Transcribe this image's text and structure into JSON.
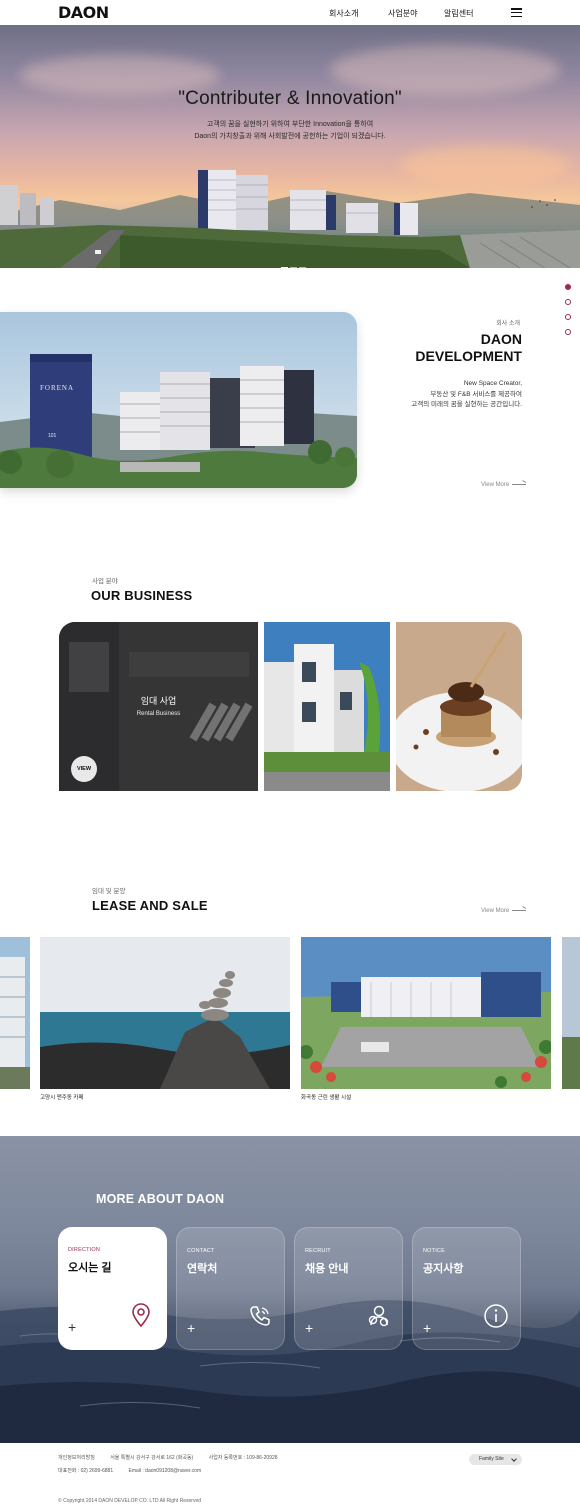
{
  "header": {
    "logo": "DAON",
    "nav": [
      "회사소개",
      "사업분야",
      "알림센터"
    ]
  },
  "hero": {
    "title": "\"Contributer & Innovation\"",
    "subtitle_line1": "고객의 꿈을 실현하기 위하여 부단한 Innovation을 통하여",
    "subtitle_line2": "Daon의 가치창출과 위해 사회발전에 공헌하는 기업이 되겠습니다."
  },
  "about": {
    "kicker": "회사 소개",
    "title_line1": "DAON",
    "title_line2": "DEVELOPMENT",
    "desc_line1": "New Space Creator,",
    "desc_line2": "부동산 및 F&B 서비스를 제공하여",
    "desc_line3": "고객의 미래의 꿈을 실현하는 공간입니다.",
    "view_more": "View More",
    "building_sign": "FORENA",
    "building_number": "101"
  },
  "business": {
    "kicker": "사업 분야",
    "title": "OUR BUSINESS",
    "card_label": "임대 사업",
    "card_sub": "Rental Business",
    "view_button": "VIEW"
  },
  "lease": {
    "kicker": "임대 및 분양",
    "title": "LEASE AND SALE",
    "view_more": "View More",
    "captions": [
      "고양시 맨주동 카페",
      "화곡동 근린 생활 시설"
    ]
  },
  "more": {
    "title": "MORE ABOUT DAON",
    "cards": [
      {
        "kicker": "DIRECTION",
        "title": "오시는 길",
        "icon": "location-pin-icon"
      },
      {
        "kicker": "CONTACT",
        "title": "연락처",
        "icon": "phone-icon"
      },
      {
        "kicker": "RECRUIT",
        "title": "채용 안내",
        "icon": "people-icon"
      },
      {
        "kicker": "NOTICE",
        "title": "공지사항",
        "icon": "info-icon"
      }
    ],
    "plus": "+"
  },
  "footer": {
    "line1": [
      "개인정보처리방침",
      "서울 특별시 강서구 강서로 162 (화곡동)",
      "사업자 등록번호 : 109-86-20928"
    ],
    "line2": [
      "대표전화 : 02) 2699-6881",
      "Email : daon091208@naver.com"
    ],
    "family_site": "Family Site",
    "copyright": "Copyright 2014 DAON DEVELOP CO. LTD All Right Reserved"
  },
  "colors": {
    "accent": "#9b2c4b",
    "text": "#111111"
  }
}
